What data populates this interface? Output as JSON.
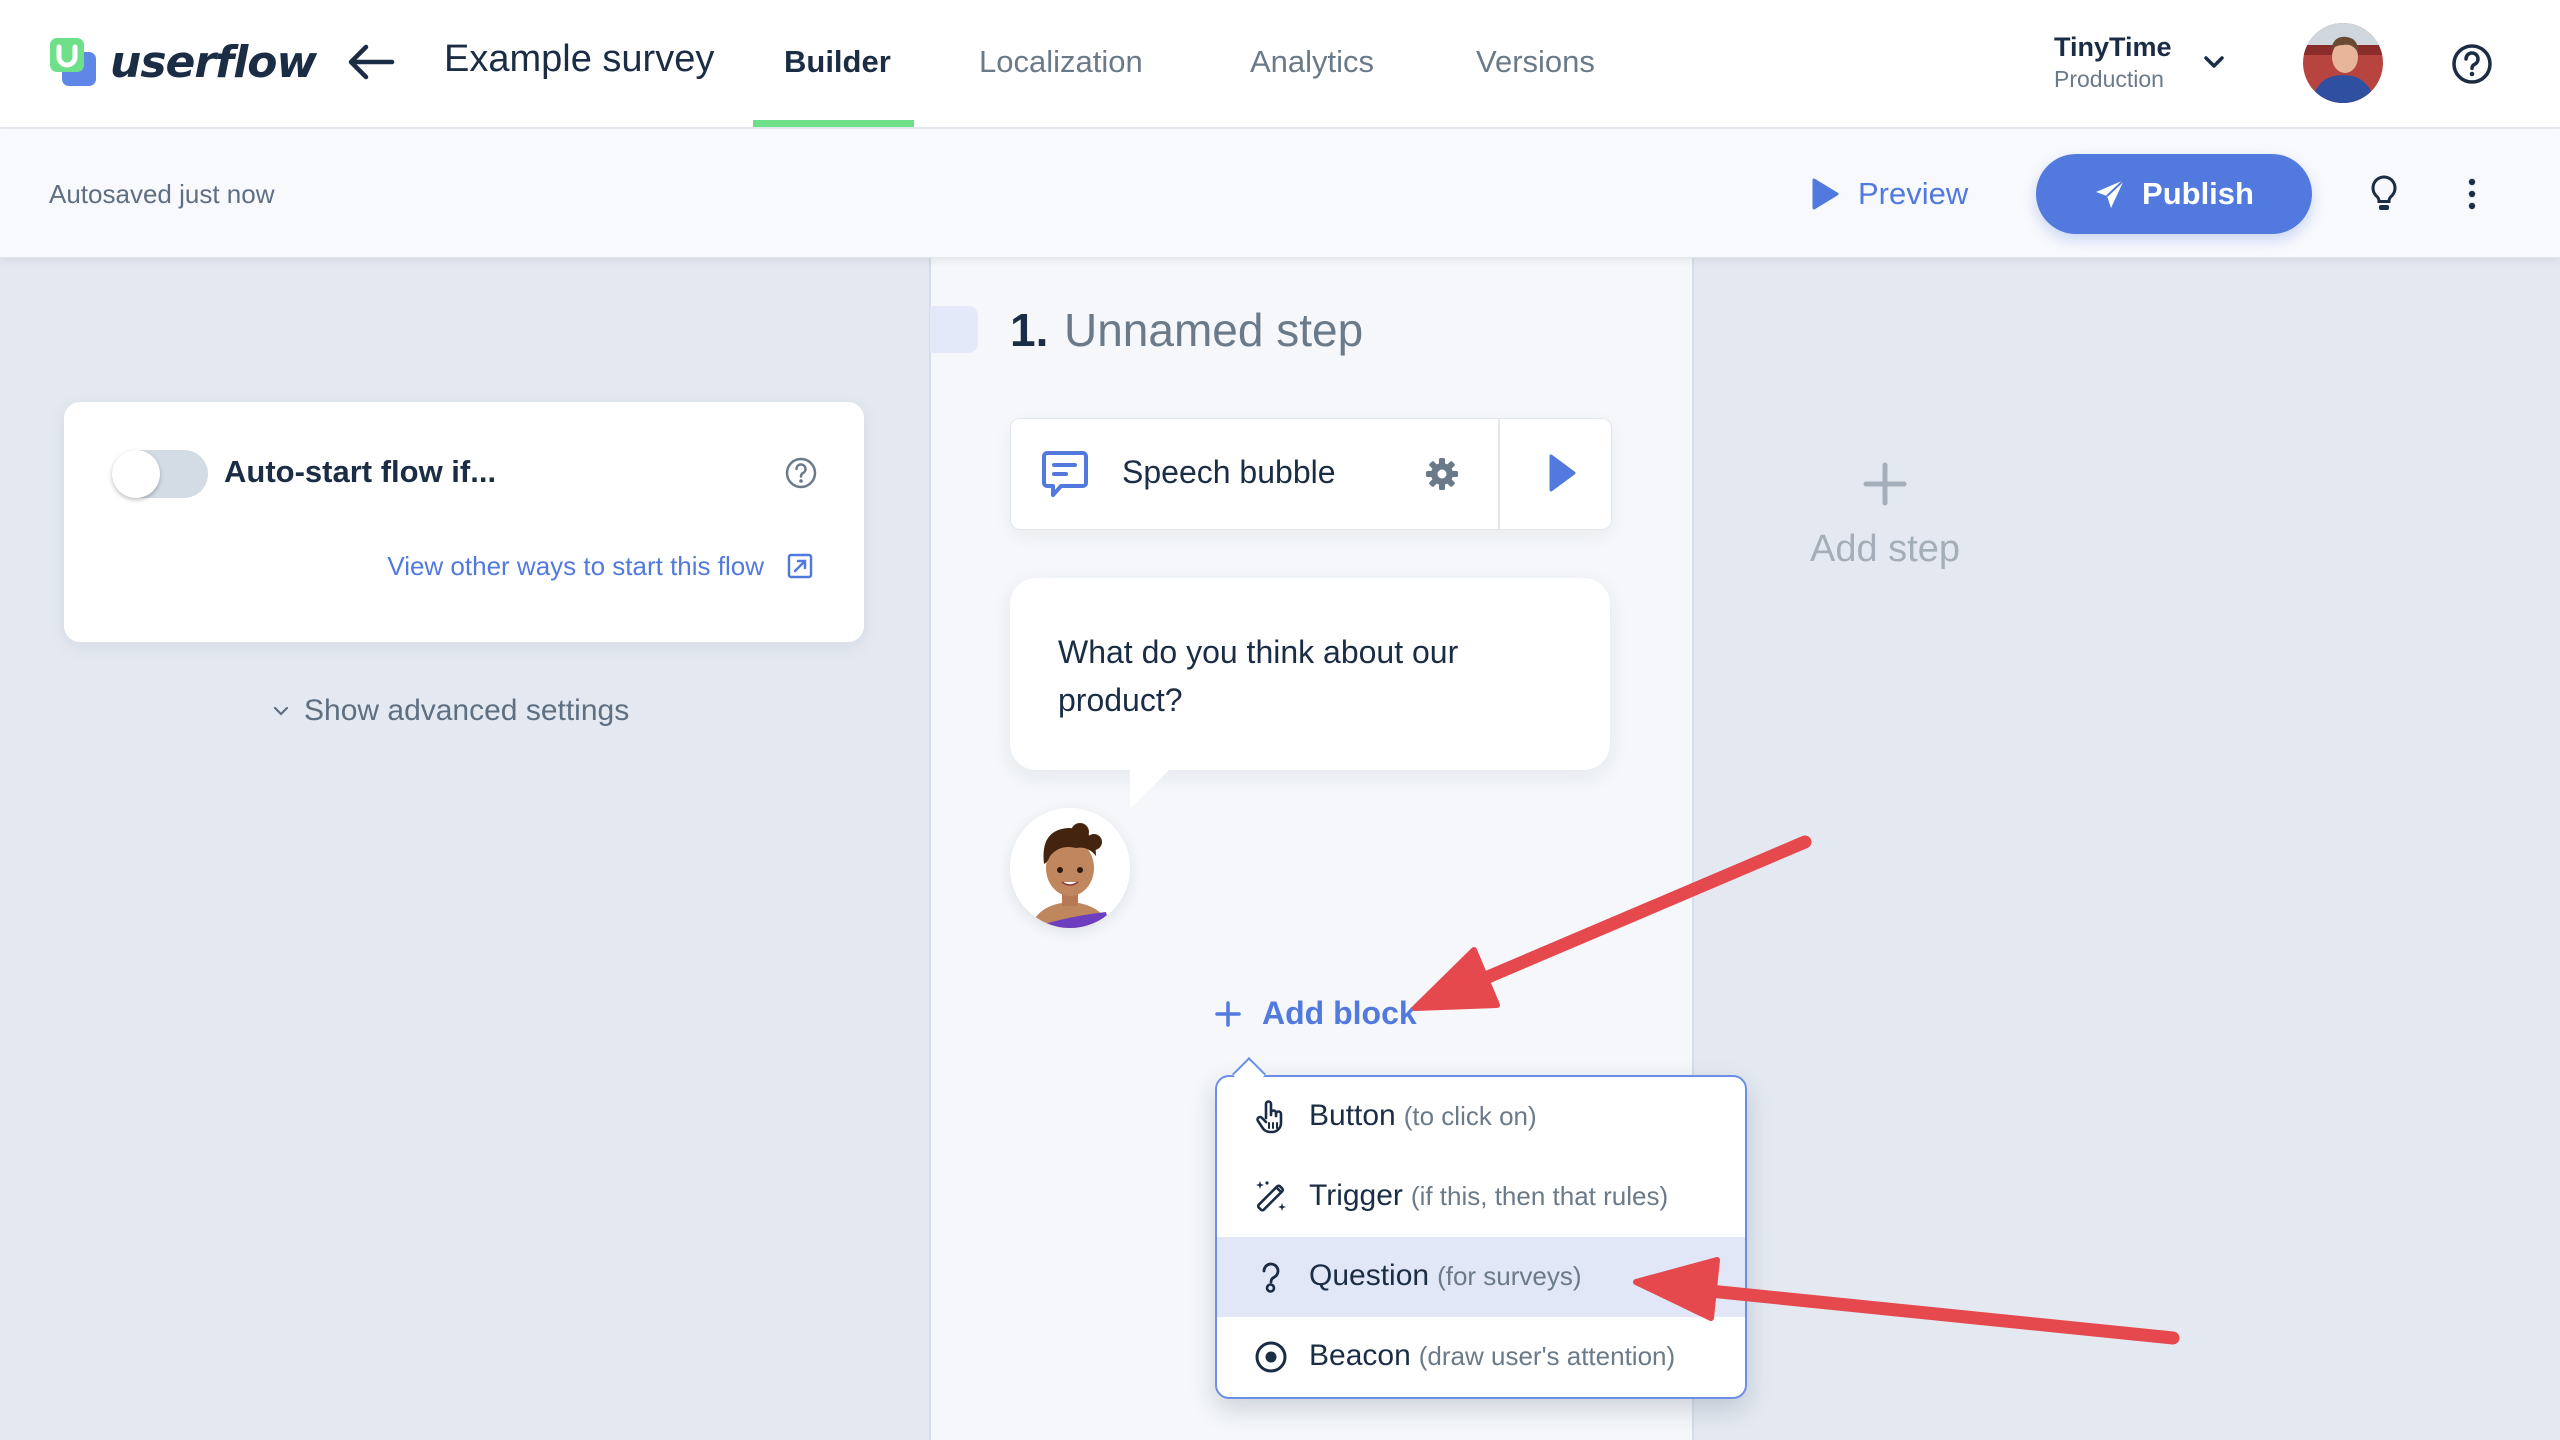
{
  "header": {
    "logo_text": "userflow",
    "flow_title": "Example survey",
    "tabs": [
      {
        "label": "Builder",
        "active": true
      },
      {
        "label": "Localization",
        "active": false
      },
      {
        "label": "Analytics",
        "active": false
      },
      {
        "label": "Versions",
        "active": false
      }
    ],
    "org": {
      "name": "TinyTime",
      "environment": "Production"
    },
    "accent_color": "#6ee08a"
  },
  "toolbar": {
    "autosave_status": "Autosaved just now",
    "preview_label": "Preview",
    "publish_label": "Publish",
    "primary_color": "#527ade"
  },
  "start_settings": {
    "autostart_label": "Auto-start flow if...",
    "autostart_enabled": false,
    "other_ways_link": "View other ways to start this flow",
    "advanced_label": "Show advanced settings"
  },
  "step": {
    "number": "1.",
    "name": "Unnamed step",
    "block": {
      "type_label": "Speech bubble"
    },
    "bubble_text": "What do you think about our product?",
    "add_block_label": "Add block"
  },
  "block_menu": {
    "items": [
      {
        "label": "Button",
        "hint": "(to click on)",
        "icon": "pointer-hand-icon",
        "highlighted": false
      },
      {
        "label": "Trigger",
        "hint": "(if this, then that rules)",
        "icon": "magic-wand-icon",
        "highlighted": false
      },
      {
        "label": "Question",
        "hint": "(for surveys)",
        "icon": "question-icon",
        "highlighted": true
      },
      {
        "label": "Beacon",
        "hint": "(draw user's attention)",
        "icon": "beacon-icon",
        "highlighted": false
      }
    ]
  },
  "add_step_label": "Add step",
  "annotations": {
    "arrow_color": "#e5484d",
    "arrows": [
      {
        "points_to": "Add block"
      },
      {
        "points_to": "Question (for surveys)"
      }
    ]
  }
}
